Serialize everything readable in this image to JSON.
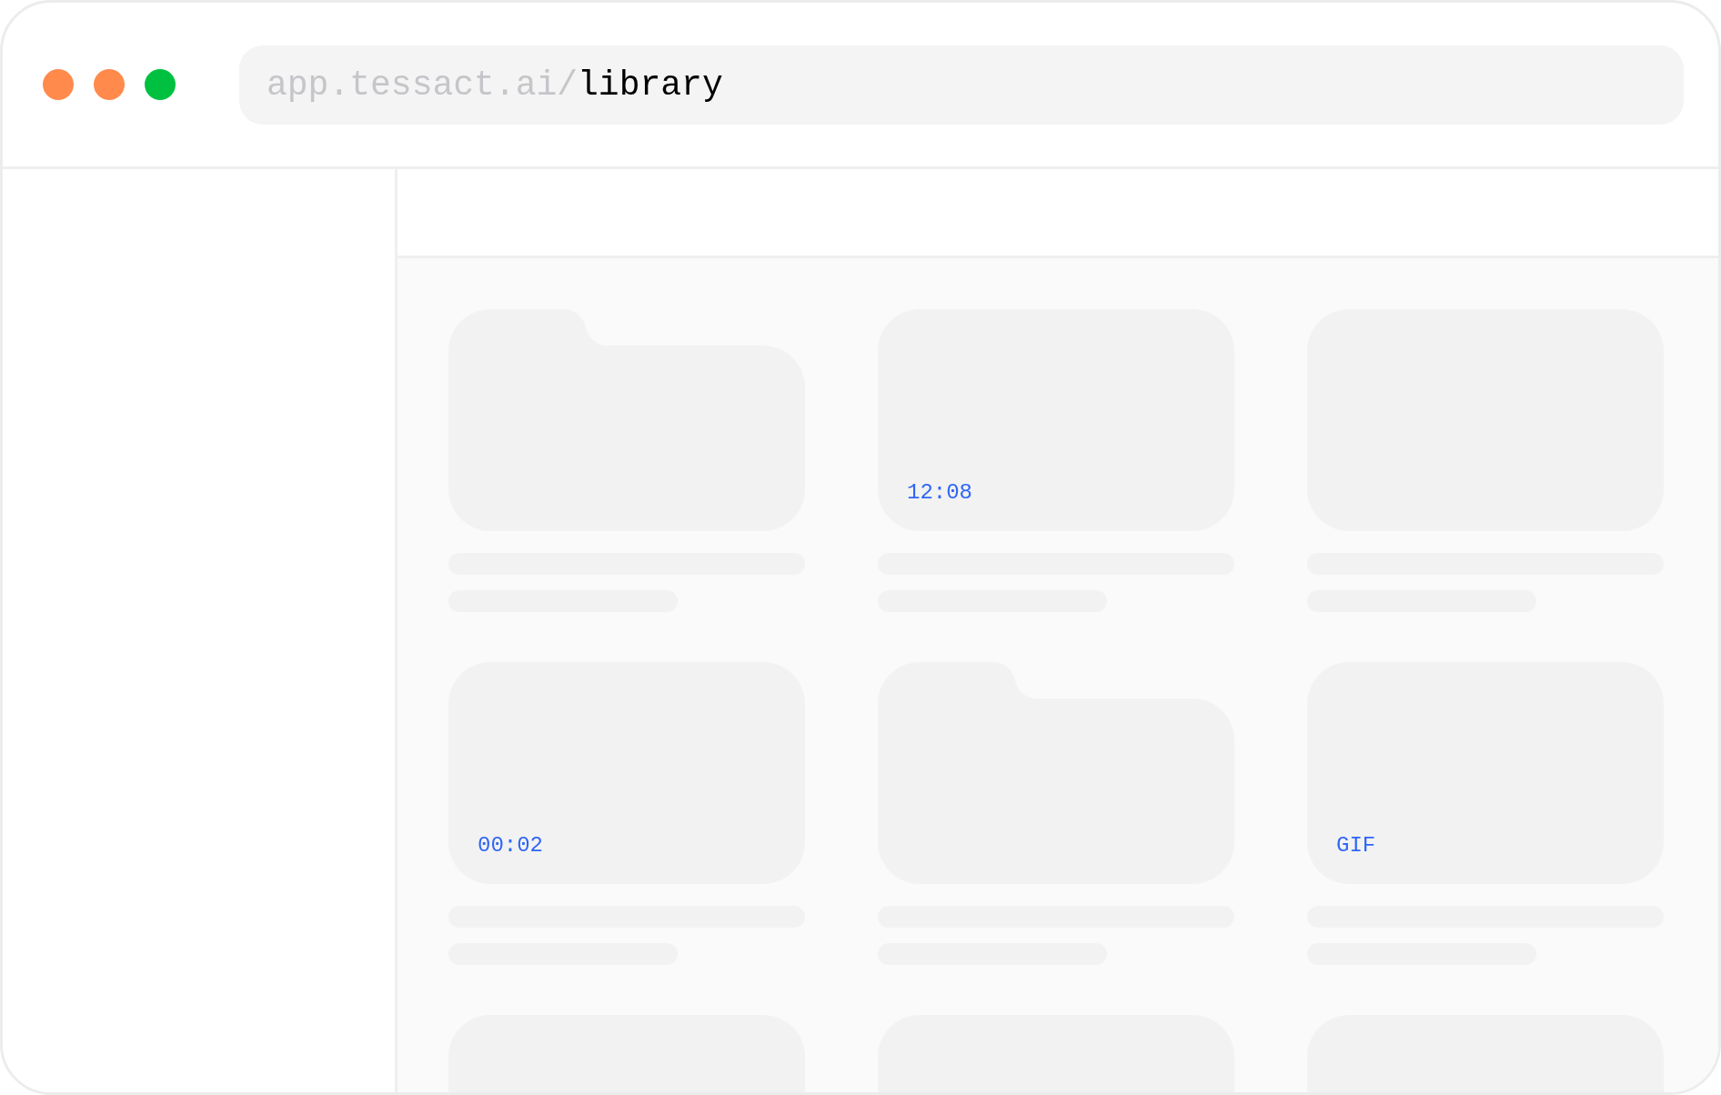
{
  "window": {
    "controls": [
      {
        "color": "#ff8a4c"
      },
      {
        "color": "#ff8a4c"
      },
      {
        "color": "#00c040"
      }
    ]
  },
  "address_bar": {
    "host": "app.tessact.ai/",
    "path": "library"
  },
  "library": {
    "items": [
      {
        "kind": "folder"
      },
      {
        "kind": "media",
        "badge": "12:08"
      },
      {
        "kind": "media"
      },
      {
        "kind": "media",
        "badge": "00:02"
      },
      {
        "kind": "folder"
      },
      {
        "kind": "media",
        "badge": "GIF"
      }
    ],
    "partly_visible_items": [
      {
        "kind": "media"
      },
      {
        "kind": "media"
      },
      {
        "kind": "media"
      }
    ]
  }
}
